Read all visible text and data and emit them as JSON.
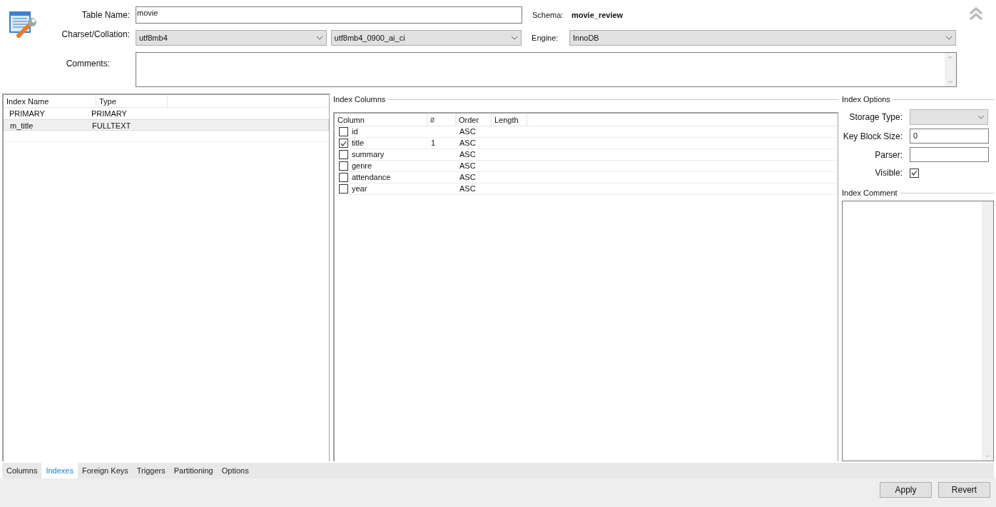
{
  "header": {
    "table_name_label": "Table Name:",
    "table_name": "movie",
    "schema_label": "Schema:",
    "schema": "movie_review",
    "charset_label": "Charset/Collation:",
    "charset": "utf8mb4",
    "collation": "utf8mb4_0900_ai_ci",
    "engine_label": "Engine:",
    "engine": "InnoDB",
    "comments_label": "Comments:"
  },
  "index_table": {
    "columns": [
      "Index Name",
      "Type"
    ],
    "rows": [
      {
        "name": "PRIMARY",
        "type": "PRIMARY",
        "selected": false
      },
      {
        "name": "m_title",
        "type": "FULLTEXT",
        "selected": true
      }
    ]
  },
  "index_columns": {
    "title": "Index Columns",
    "columns": [
      "Column",
      "#",
      "Order",
      "Length"
    ],
    "rows": [
      {
        "column": "id",
        "checked": false,
        "order": "ASC"
      },
      {
        "column": "title",
        "checked": true,
        "number": "1",
        "order": "ASC"
      },
      {
        "column": "summary",
        "checked": false,
        "order": "ASC"
      },
      {
        "column": "genre",
        "checked": false,
        "order": "ASC"
      },
      {
        "column": "attendance",
        "checked": false,
        "order": "ASC"
      },
      {
        "column": "year",
        "checked": false,
        "order": "ASC"
      }
    ]
  },
  "index_options": {
    "title": "Index Options",
    "storage_type_label": "Storage Type:",
    "key_block_size_label": "Key Block Size:",
    "key_block_size": "0",
    "parser_label": "Parser:",
    "visible_label": "Visible:",
    "visible": true,
    "comment_title": "Index Comment"
  },
  "tabs": [
    {
      "label": "Columns",
      "selected": false
    },
    {
      "label": "Indexes",
      "selected": true
    },
    {
      "label": "Foreign Keys",
      "selected": false
    },
    {
      "label": "Triggers",
      "selected": false
    },
    {
      "label": "Partitioning",
      "selected": false
    },
    {
      "label": "Options",
      "selected": false
    }
  ],
  "buttons": [
    "Apply",
    "Revert"
  ]
}
